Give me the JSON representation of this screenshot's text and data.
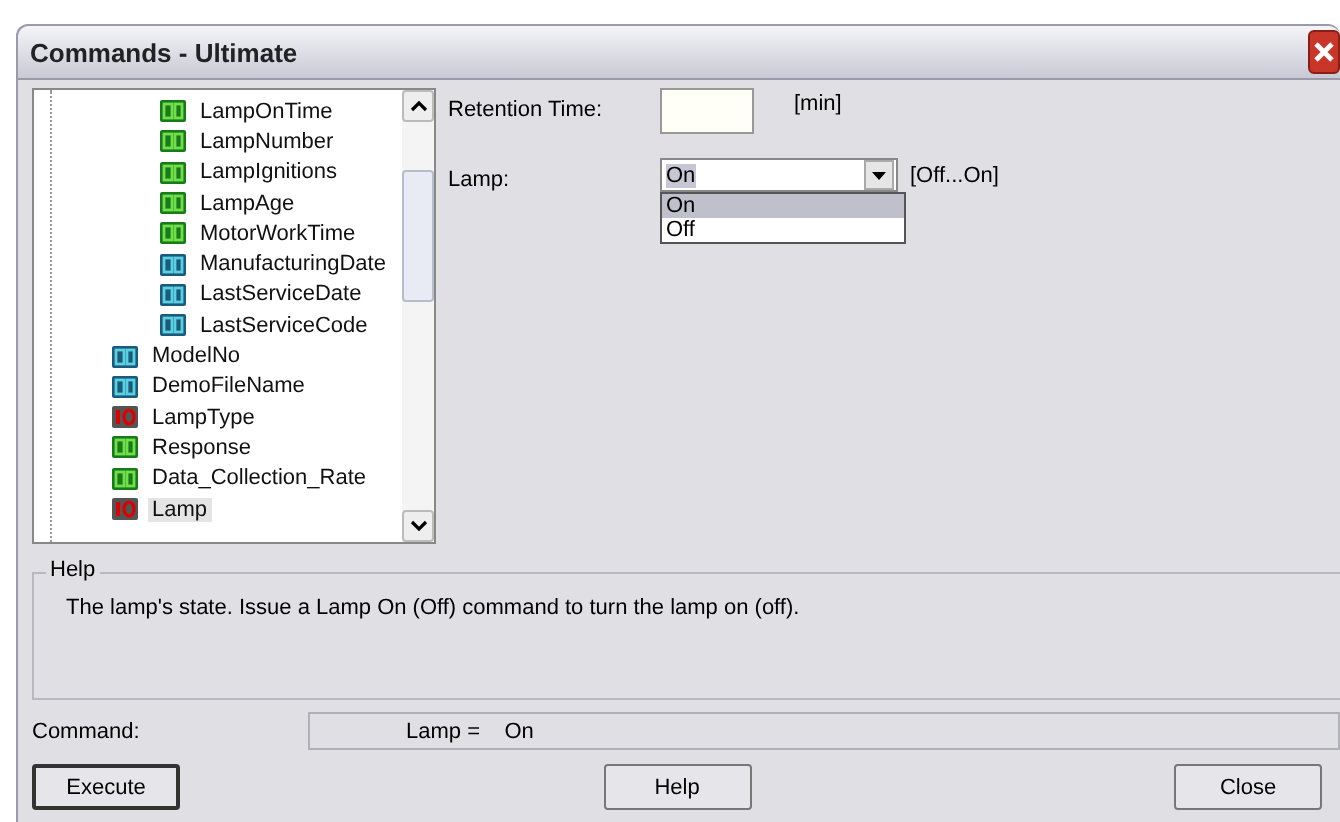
{
  "window": {
    "title": "Commands - Ultimate"
  },
  "tree": {
    "items": [
      {
        "children": [
          {
            "label": "LampOnTime",
            "kind": "number",
            "selected": false
          },
          {
            "label": "LampNumber",
            "kind": "number",
            "selected": false
          },
          {
            "label": "LampIgnitions",
            "kind": "number",
            "selected": false
          },
          {
            "label": "LampAge",
            "kind": "number",
            "selected": false
          },
          {
            "label": "MotorWorkTime",
            "kind": "number",
            "selected": false
          },
          {
            "label": "ManufacturingDate",
            "kind": "text",
            "selected": false
          },
          {
            "label": "LastServiceDate",
            "kind": "text",
            "selected": false
          },
          {
            "label": "LastServiceCode",
            "kind": "text",
            "selected": false
          }
        ]
      },
      {
        "label": "ModelNo",
        "kind": "text",
        "selected": false
      },
      {
        "label": "DemoFileName",
        "kind": "text",
        "selected": false
      },
      {
        "label": "LampType",
        "kind": "io",
        "selected": false
      },
      {
        "label": "Response",
        "kind": "number",
        "selected": false
      },
      {
        "label": "Data_Collection_Rate",
        "kind": "number",
        "selected": false
      },
      {
        "label": "Lamp",
        "kind": "io",
        "selected": true
      }
    ]
  },
  "retention": {
    "label": "Retention Time:",
    "unit": "[min]"
  },
  "lamp": {
    "label": "Lamp:",
    "value": "On",
    "range": "[Off...On]",
    "options": [
      {
        "label": "On",
        "selected": true
      },
      {
        "label": "Off",
        "selected": false
      }
    ]
  },
  "help": {
    "title": "Help",
    "text": "The lamp's state. Issue a Lamp On (Off) command to turn the lamp on (off)."
  },
  "command": {
    "label": "Command:",
    "value": "Lamp =    On"
  },
  "buttons": [
    "Execute",
    "Help",
    "Close"
  ]
}
